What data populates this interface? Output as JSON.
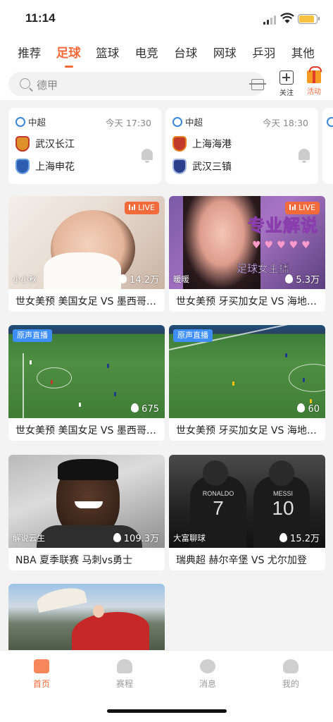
{
  "status_bar": {
    "time": "11:14"
  },
  "tabs": [
    "推荐",
    "足球",
    "篮球",
    "电竞",
    "台球",
    "网球",
    "乒羽",
    "其他"
  ],
  "active_tab": "足球",
  "search": {
    "placeholder": "德甲"
  },
  "header_actions": {
    "follow_label": "关注",
    "activity_label": "活动"
  },
  "matches": [
    {
      "league": "中超",
      "time": "今天 17:30",
      "home": "武汉长江",
      "away": "上海申花"
    },
    {
      "league": "中超",
      "time": "今天 18:30",
      "home": "上海海港",
      "away": "武汉三镇"
    }
  ],
  "videos": [
    {
      "title": "世女美预 美国女足 VS 墨西哥…",
      "anchor": "小小秋",
      "heat": "14.2万",
      "badge": "LIVE"
    },
    {
      "title": "世女美预 牙买加女足 VS 海地…",
      "anchor": "暖暖",
      "heat": "5.3万",
      "badge": "LIVE",
      "overlay_title": "专业解说",
      "overlay_sub": "足球女主播"
    },
    {
      "title": "世女美预 美国女足 VS 墨西哥…",
      "anchor": "",
      "heat": "675",
      "badge": "原声直播"
    },
    {
      "title": "世女美预 牙买加女足 VS 海地…",
      "anchor": "",
      "heat": "60",
      "badge": "原声直播"
    },
    {
      "title": "NBA 夏季联赛 马刺vs勇士",
      "anchor": "解说云生",
      "heat": "109.3万"
    },
    {
      "title": "瑞典超 赫尔辛堡 VS 尤尔加登",
      "anchor": "大富聊球",
      "heat": "15.2万",
      "jersey_left": "RONALDO",
      "jersey_left_num": "7",
      "jersey_right": "MESSI",
      "jersey_right_num": "10"
    }
  ],
  "bottom_nav": [
    {
      "label": "首页",
      "icon": "home-icon",
      "active": true
    },
    {
      "label": "赛程",
      "icon": "trophy-icon"
    },
    {
      "label": "消息",
      "icon": "message-icon"
    },
    {
      "label": "我的",
      "icon": "profile-icon"
    }
  ],
  "colors": {
    "accent": "#f36b3a",
    "badge_blue": "#3e8ef7",
    "background": "#f3f3f3"
  }
}
